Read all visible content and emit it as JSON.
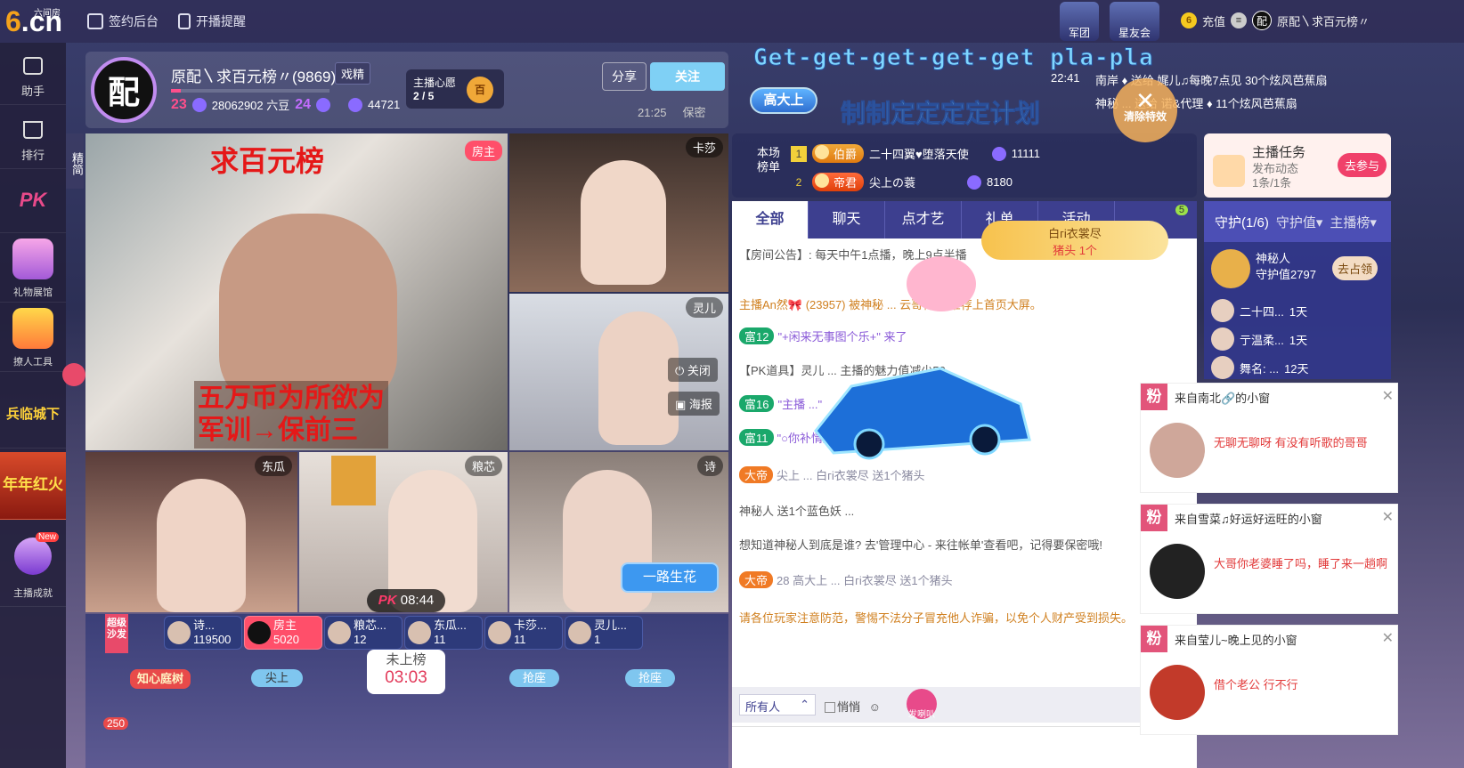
{
  "top": {
    "logo_main": "6.cn",
    "logo_sub": "六间房",
    "nav": [
      {
        "label": "签约后台"
      },
      {
        "label": "开播提醒"
      }
    ],
    "badges": [
      {
        "label": "军团"
      },
      {
        "label": "星友会"
      }
    ],
    "recharge": "充值",
    "user_name": "原配〵求百元榜〃",
    "coin_label": "6"
  },
  "sidebar": {
    "items": [
      {
        "label": "助手"
      },
      {
        "label": "排行"
      },
      {
        "label": "PK"
      },
      {
        "label": "礼物展馆"
      },
      {
        "label": "撩人工具"
      },
      {
        "label": "兵临城下"
      },
      {
        "label": "年年红火"
      },
      {
        "label": "主播成就"
      }
    ],
    "new_badge": "New",
    "jingjian": "精简"
  },
  "room": {
    "avatar_char": "配",
    "title": "原配〵求百元榜〃(9869)",
    "tag": "戏精",
    "lvl1": "23",
    "beans": "28062902 六豆",
    "lvl2": "24",
    "fans": "44721",
    "wish_title": "主播心愿",
    "wish_progress": "2 / 5",
    "wish_icon": "百",
    "share": "分享",
    "follow": "关注",
    "time": "21:25",
    "secret": "保密"
  },
  "marquee": {
    "line1": "Get-get-get-get-get pla-pla",
    "line2": "制制定定定定计划",
    "gaoda": "高大上",
    "clear_fx": "清除特效",
    "ticker_time": "22:41",
    "ticker1": "南岸 ♦ 送给 娓儿♫每晚7点见 30个炫风芭蕉扇",
    "ticker2": "神秘 ... 送给 诺&代理 ♦ 11个炫风芭蕉扇"
  },
  "video": {
    "main_tag": "房主",
    "main_top_text": "求百元榜",
    "main_bottom_line1": "五万币为所欲为",
    "main_bottom_line2": "军训→保前三",
    "tiles": [
      {
        "name": "卡莎"
      },
      {
        "name": "灵儿"
      },
      {
        "name": "东瓜"
      },
      {
        "name": "粮芯"
      },
      {
        "name": "诗"
      }
    ],
    "close_btn": "关闭",
    "poster_btn": "海报",
    "pk_label": "PK",
    "pk_time": "08:44",
    "flower_btn": "一路生花",
    "rank_label": "未上榜",
    "rank_time": "03:03"
  },
  "seats": [
    {
      "name": "诗...",
      "score": "119500"
    },
    {
      "name": "房主",
      "score": "5020"
    },
    {
      "name": "粮芯...",
      "score": "12"
    },
    {
      "name": "东瓜...",
      "score": "11"
    },
    {
      "name": "卡莎...",
      "score": "11"
    },
    {
      "name": "灵儿...",
      "score": "1"
    }
  ],
  "bottom": {
    "super_sofa": "超级沙发",
    "court": "知心庭树",
    "seat_grab1": "尖上",
    "seat_grab2": "抢座",
    "seat_grab3": "抢座",
    "count": "250"
  },
  "topuser": {
    "label1": "本场",
    "label2": "榜单",
    "rows": [
      {
        "rank": "1",
        "noble": "伯爵",
        "name": "二十四翼♥堕落天使",
        "score": "11111"
      },
      {
        "rank": "2",
        "noble": "帝君",
        "name": "尖上の蓑",
        "score": "8180"
      }
    ]
  },
  "chat": {
    "tabs": [
      {
        "label": "全部"
      },
      {
        "label": "聊天"
      },
      {
        "label": "点才艺"
      },
      {
        "label": "礼单"
      },
      {
        "label": "活动"
      }
    ],
    "tab_badge": "5",
    "gift_banner_line1": "白гi衣裳尽",
    "gift_banner_line2": "猪头 1个",
    "messages": [
      {
        "text": "【房间公告】: 每天中午1点播，晚上9点半播"
      },
      {
        "text": "主播An然🎀 (23957) 被神秘 ... 云哥神君 推荐上首页大屏。"
      },
      {
        "chip": "富12",
        "text": "\"+闲来无事图个乐+\" 来了"
      },
      {
        "text": "【PK道具】灵儿 ... 主播的魅力值减少50"
      },
      {
        "chip": "富16",
        "text": "\"主播 ...\""
      },
      {
        "chip": "富11",
        "text": "\"○你补情好...\""
      },
      {
        "chip": "大帝",
        "text": "尖上 ... 白гi衣裳尽 送1个猪头"
      },
      {
        "text": "神秘人 送1个蓝色妖 ..."
      },
      {
        "text": "想知道神秘人到底是谁? 去'管理中心 - 来往帐单'查看吧，记得要保密哦!"
      },
      {
        "chip": "大帝",
        "text": "28 高大上 ... 白гi衣裳尽 送1个猪头"
      }
    ],
    "warning": "请各位玩家注意防范，警惕不法分子冒充他人诈骗，以免个人财产受到损失。",
    "select_value": "所有人",
    "whisper": "悄悄",
    "shout": "发喇叭"
  },
  "task": {
    "title": "主播任务",
    "sub1": "发布动态",
    "sub2": "1条/1条",
    "btn": "去参与"
  },
  "guard": {
    "tabs": [
      {
        "label": "守护(1/6)"
      },
      {
        "label": "守护值▾"
      },
      {
        "label": "主播榜▾"
      }
    ],
    "top_name": "神秘人",
    "top_value": "守护值2797",
    "grab_btn": "去占领",
    "rows": [
      {
        "name": "二十四...",
        "days": "1天"
      },
      {
        "name": "亍温柔...",
        "days": "1天"
      },
      {
        "name": "舞名: ...",
        "days": "12天"
      }
    ]
  },
  "notifications": [
    {
      "title": "来自南北🔗的小窗",
      "msg": "无聊无聊呀 有没有听歌的哥哥"
    },
    {
      "title": "来自雪菜♫好运好运旺的小窗",
      "msg": "大哥你老婆睡了吗，睡了来一趟啊"
    },
    {
      "title": "来自莹儿~晚上见的小窗",
      "msg": "借个老公 行不行"
    }
  ],
  "fan_badge": "粉"
}
